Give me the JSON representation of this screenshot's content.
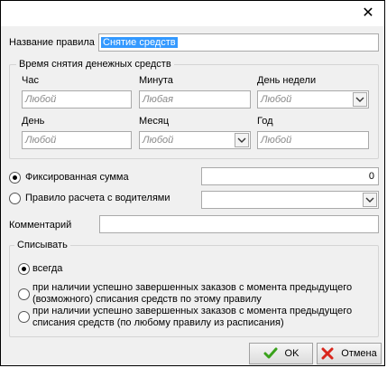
{
  "titlebar": {
    "close_glyph": "✕"
  },
  "rule_name": {
    "label": "Название правила",
    "value": "Снятие средств"
  },
  "schedule": {
    "group_title": "Время снятия денежных средств",
    "hour": {
      "label": "Час",
      "placeholder": "Любой"
    },
    "minute": {
      "label": "Минута",
      "placeholder": "Любая"
    },
    "weekday": {
      "label": "День недели",
      "placeholder": "Любой"
    },
    "day": {
      "label": "День",
      "placeholder": "Любой"
    },
    "month": {
      "label": "Месяц",
      "placeholder": "Любой"
    },
    "year": {
      "label": "Год",
      "placeholder": "Любой"
    }
  },
  "amount": {
    "fixed_label": "Фиксированная сумма",
    "fixed_value": "0",
    "driver_rule_label": "Правило расчета с водителями",
    "selected": "fixed"
  },
  "comment": {
    "label": "Комментарий",
    "value": ""
  },
  "debit": {
    "group_title": "Списывать",
    "options": [
      "всегда",
      "при наличии успешно завершенных заказов с момента предыдущего (возможного) списания средств по этому правилу",
      "при наличии успешно завершенных заказов с момента предыдущего списания средств (по любому правилу из расписания)"
    ],
    "option_lines": [
      [
        "всегда"
      ],
      [
        "при наличии успешно завершенных заказов с момента предыдущего",
        "(возможного) списания средств по этому правилу"
      ],
      [
        "при наличии успешно завершенных заказов с момента предыдущего",
        "списания средств (по любому правилу из расписания)"
      ]
    ],
    "selected_index": 0
  },
  "buttons": {
    "ok": "OK",
    "cancel": "Отмена"
  },
  "colors": {
    "ok_icon": "#3aa21c",
    "cancel_icon": "#d9261c",
    "selection": "#3399ff"
  }
}
